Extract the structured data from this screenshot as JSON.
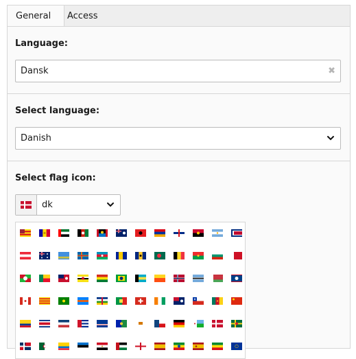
{
  "tabs": [
    {
      "label": "General",
      "active": true
    },
    {
      "label": "Access",
      "active": false
    }
  ],
  "language": {
    "label": "Language:",
    "value": "Dansk",
    "clear_glyph": "✖"
  },
  "select_language": {
    "label": "Select language:",
    "value": "Danish"
  },
  "flag_icon": {
    "label": "Select flag icon:",
    "value": "dk",
    "selected_flag": "dk"
  },
  "flags": [
    [
      "es-ca",
      "ad",
      "ae",
      "af",
      "ag",
      "ai",
      "al",
      "am",
      "an",
      "ao",
      "ar",
      "as"
    ],
    [
      "at",
      "au",
      "aw",
      "ax",
      "az",
      "ba",
      "bb",
      "bd",
      "be",
      "bf",
      "bg",
      "bh"
    ],
    [
      "bi",
      "bj",
      "bm",
      "bn",
      "bo",
      "br",
      "bs",
      "bt",
      "bv",
      "bw",
      "by",
      "bz"
    ],
    [
      "ca",
      "catalonia",
      "cc",
      "cd",
      "cf",
      "cg",
      "ch",
      "ci",
      "ck",
      "cl",
      "cm",
      "cn"
    ],
    [
      "co",
      "cr",
      "cs",
      "cu",
      "cv",
      "cx",
      "cy",
      "cz",
      "de",
      "dj",
      "dk",
      "dm"
    ],
    [
      "do",
      "dz",
      "ec",
      "ee",
      "eg",
      "eh",
      "en",
      "es",
      "et",
      "eu-sp",
      "et2",
      "eu"
    ]
  ],
  "colors": {
    "panel_bg": "#fafafa",
    "border": "#d6d6d6",
    "tab_bg": "#eeeeee"
  }
}
